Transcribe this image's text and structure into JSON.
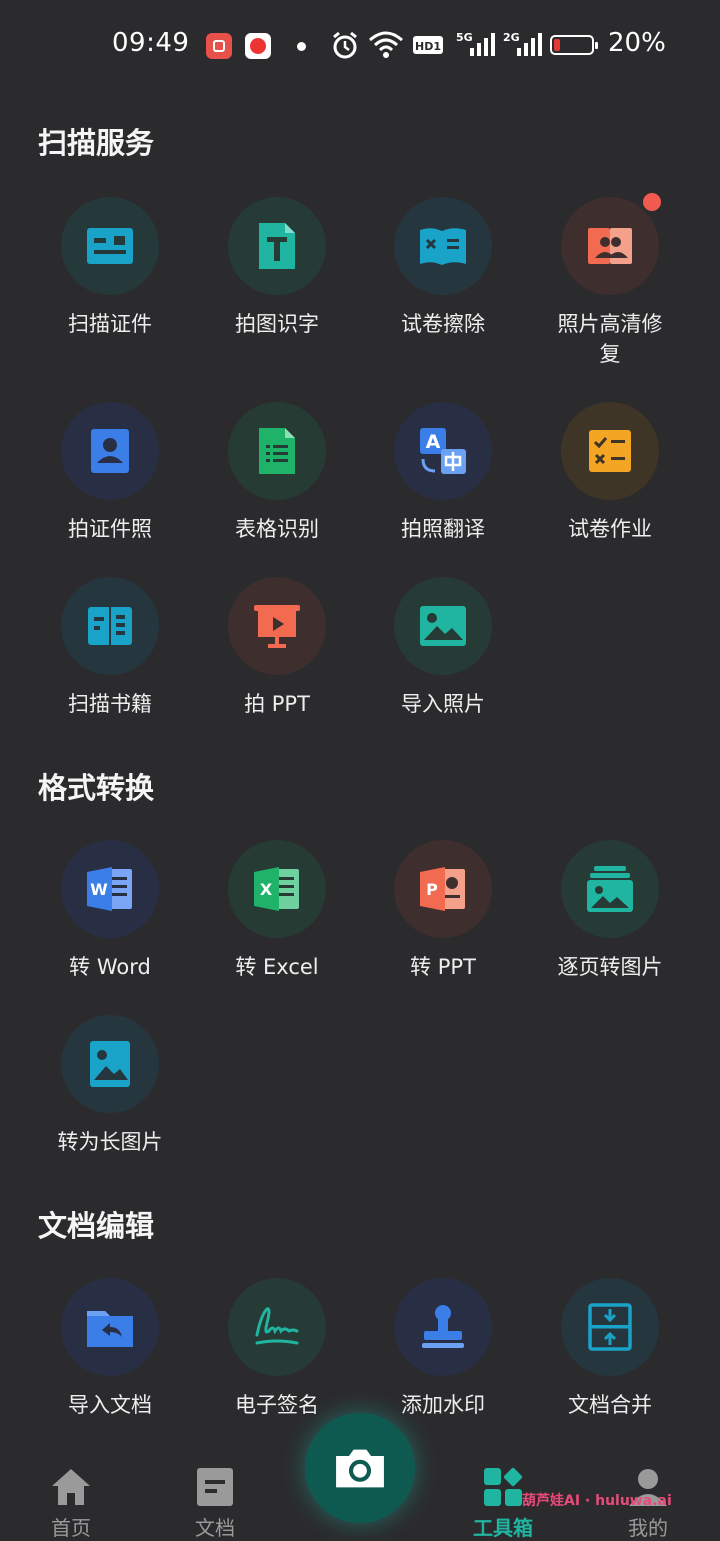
{
  "status_bar": {
    "time": "09:49",
    "battery_percent": "20%",
    "network1": "5G",
    "network2": "2G",
    "hd": "HD1"
  },
  "sections": [
    {
      "title": "扫描服务"
    },
    {
      "title": "格式转换"
    },
    {
      "title": "文档编辑"
    }
  ],
  "scan_tools": [
    {
      "label": "扫描证件",
      "icon": "id-card-icon"
    },
    {
      "label": "拍图识字",
      "icon": "text-recognition-icon"
    },
    {
      "label": "试卷擦除",
      "icon": "exam-erase-icon"
    },
    {
      "label": "照片高清修\n复",
      "icon": "photo-restore-icon",
      "badge": true
    },
    {
      "label": "拍证件照",
      "icon": "id-photo-icon"
    },
    {
      "label": "表格识别",
      "icon": "table-recognition-icon"
    },
    {
      "label": "拍照翻译",
      "icon": "translate-icon"
    },
    {
      "label": "试卷作业",
      "icon": "homework-icon"
    },
    {
      "label": "扫描书籍",
      "icon": "book-scan-icon"
    },
    {
      "label": "拍 PPT",
      "icon": "ppt-capture-icon"
    },
    {
      "label": "导入照片",
      "icon": "import-photo-icon"
    }
  ],
  "convert_tools": [
    {
      "label": "转 Word",
      "icon": "word-icon"
    },
    {
      "label": "转 Excel",
      "icon": "excel-icon"
    },
    {
      "label": "转 PPT",
      "icon": "ppt-icon"
    },
    {
      "label": "逐页转图片",
      "icon": "pages-to-images-icon"
    },
    {
      "label": "转为长图片",
      "icon": "long-image-icon"
    }
  ],
  "edit_tools": [
    {
      "label": "导入文档",
      "icon": "import-document-icon"
    },
    {
      "label": "电子签名",
      "icon": "signature-icon"
    },
    {
      "label": "添加水印",
      "icon": "watermark-stamp-icon"
    },
    {
      "label": "文档合并",
      "icon": "merge-document-icon"
    }
  ],
  "bottom_nav": [
    {
      "label": "首页",
      "icon": "home-icon"
    },
    {
      "label": "文档",
      "icon": "document-icon"
    },
    {
      "label": "工具箱",
      "icon": "toolbox-icon",
      "active": true
    },
    {
      "label": "我的",
      "icon": "profile-icon"
    }
  ],
  "watermark": "葫芦娃AI · huluwa.ai",
  "colors": {
    "accent": "#1fb5a1",
    "background": "#2b2b2d",
    "badge": "#f05a4f"
  }
}
